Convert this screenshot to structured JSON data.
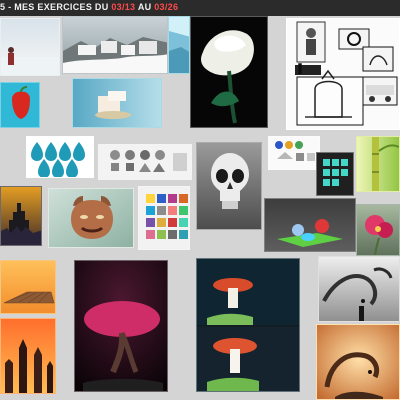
{
  "header": {
    "prefix": "5 - MES EXERCICES DU ",
    "date_start": "03/13",
    "middle": " AU ",
    "date_end": "03/26"
  },
  "tiles": [
    {
      "name": "tile-winter-woman",
      "bg": "#dfe6ea"
    },
    {
      "name": "tile-snow-village",
      "bg": "#9aa6ab"
    },
    {
      "name": "tile-ice-cave",
      "bg": "#78c3dc"
    },
    {
      "name": "tile-white-rose",
      "bg": "#060606"
    },
    {
      "name": "tile-pencil-sketches",
      "bg": "#ffffff"
    },
    {
      "name": "tile-red-pepper",
      "bg": "#33b9d5"
    },
    {
      "name": "tile-blue-room",
      "bg": "#7fc6d8"
    },
    {
      "name": "tile-waterdrops",
      "bg": "#ffffff"
    },
    {
      "name": "tile-shading-spheres",
      "bg": "#eeeeee"
    },
    {
      "name": "tile-skull",
      "bg": "#7e7e7e"
    },
    {
      "name": "tile-shapes-study",
      "bg": "#fafafa"
    },
    {
      "name": "tile-cubes",
      "bg": "#2a2a2a"
    },
    {
      "name": "tile-bamboo",
      "bg": "#d8e27a"
    },
    {
      "name": "tile-castle-night",
      "bg": "#1f1d22"
    },
    {
      "name": "tile-demon-head",
      "bg": "#d1ded8"
    },
    {
      "name": "tile-color-palette",
      "bg": "#f0f0f0"
    },
    {
      "name": "tile-3d-objects",
      "bg": "#3c3c3c"
    },
    {
      "name": "tile-pink-flower",
      "bg": "#7a8c7a"
    },
    {
      "name": "tile-checkerboard",
      "bg": "#f0a83e"
    },
    {
      "name": "tile-pink-tree",
      "bg": "#1a0b16"
    },
    {
      "name": "tile-mushrooms",
      "bg": "#0d2530"
    },
    {
      "name": "tile-spiral-landscape",
      "bg": "#cfcfcf"
    },
    {
      "name": "tile-orange-towers",
      "bg": "#ff8a2a"
    },
    {
      "name": "tile-orange-spiral",
      "bg": "#ffcf8b"
    }
  ]
}
